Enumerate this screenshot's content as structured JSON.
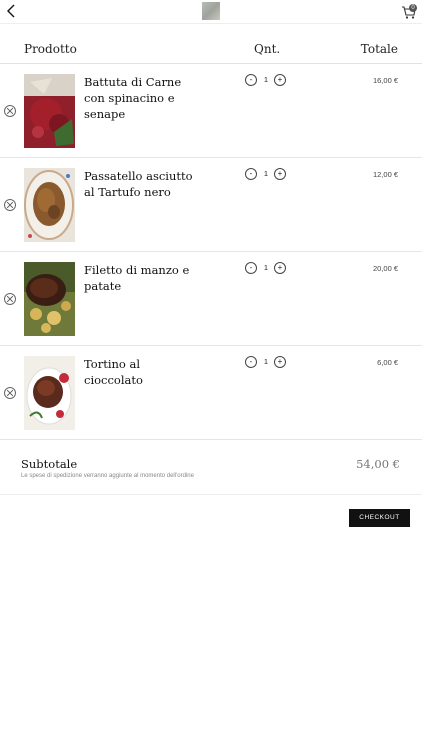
{
  "header": {
    "product_col": "Prodotto",
    "qty_col": "Qnt.",
    "total_col": "Totale",
    "cart_count": "0"
  },
  "items": [
    {
      "name": "Battuta di Carne con spinacino e senape",
      "qty": "1",
      "total": "16,00 €",
      "minus": "-",
      "plus": "+"
    },
    {
      "name": "Passatello asciutto al Tartufo nero",
      "qty": "1",
      "total": "12,00 €",
      "minus": "-",
      "plus": "+"
    },
    {
      "name": "Filetto di manzo e patate",
      "qty": "1",
      "total": "20,00 €",
      "minus": "-",
      "plus": "+"
    },
    {
      "name": "Tortino al cioccolato",
      "qty": "1",
      "total": "6,00 €",
      "minus": "-",
      "plus": "+"
    }
  ],
  "subtotal": {
    "label": "Subtotale",
    "note": "Le spese di spedizione verranno aggiunte al momento dell'ordine",
    "value": "54,00 €"
  },
  "checkout_label": "CHECKOUT",
  "icons": {
    "back": "chevron-left-icon",
    "cart": "shopping-cart-icon",
    "remove": "close-circle-icon"
  }
}
